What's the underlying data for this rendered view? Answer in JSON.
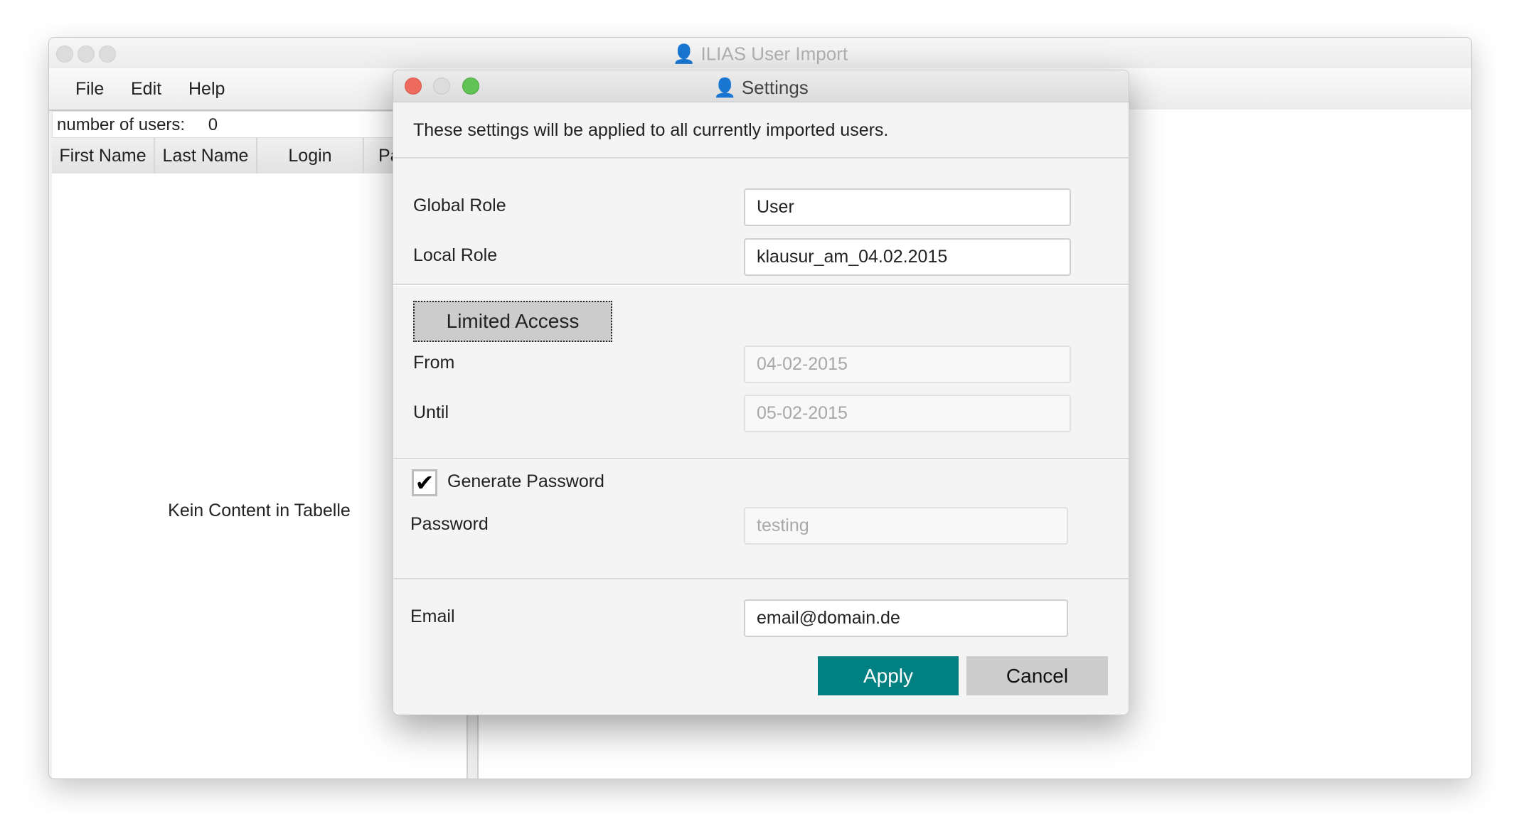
{
  "main_window": {
    "title": "ILIAS User Import",
    "app_icon": "user-gear-icon",
    "menu": [
      "File",
      "Edit",
      "Help"
    ],
    "user_count_label": "number of users:",
    "user_count": "0",
    "table": {
      "columns": [
        "First Name",
        "Last Name",
        "Login",
        "Pa"
      ],
      "empty_text": "Kein Content in Tabelle"
    }
  },
  "dialog": {
    "title": "Settings",
    "icon": "user-gear-icon",
    "description": "These settings will be applied to all currently imported users.",
    "global_role": {
      "label": "Global Role",
      "value": "User"
    },
    "local_role": {
      "label": "Local Role",
      "value": "klausur_am_04.02.2015"
    },
    "limited_access_label": "Limited Access",
    "from": {
      "label": "From",
      "value": "04-02-2015"
    },
    "until": {
      "label": "Until",
      "value": "05-02-2015"
    },
    "generate_password": {
      "label": "Generate Password",
      "checked": true
    },
    "password": {
      "label": "Password",
      "value": "testing"
    },
    "email": {
      "label": "Email",
      "value": "email@domain.de"
    },
    "apply_label": "Apply",
    "cancel_label": "Cancel"
  },
  "colors": {
    "accent": "#008080",
    "close": "#ee6a5f",
    "zoom": "#5fc454",
    "cancel_bg": "#cccccc"
  }
}
